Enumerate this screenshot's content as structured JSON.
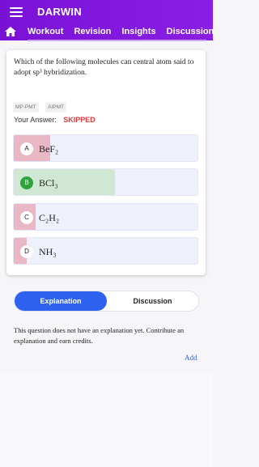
{
  "header": {
    "title": "DARWIN",
    "nav": [
      "Workout",
      "Revision",
      "Insights",
      "Discussion"
    ]
  },
  "question": {
    "text": "Which of the following molecules can central atom said to adopt sp³ hybridization.",
    "tags": [
      "MP-PMT",
      "AIPMT"
    ],
    "answer_label": "Your Answer:",
    "answer_status": "SKIPPED"
  },
  "options": [
    {
      "letter": "A",
      "formula": "BeF₂",
      "fill_fraction": 0.2,
      "fill_color": "#e9b8c4"
    },
    {
      "letter": "B",
      "formula": "BCl₃",
      "fill_fraction": 0.55,
      "fill_color": "#cfe7d3",
      "correct": true
    },
    {
      "letter": "C",
      "formula": "C₂H₂",
      "fill_fraction": 0.12,
      "fill_color": "#e9b8c4"
    },
    {
      "letter": "D",
      "formula": "NH₃",
      "fill_fraction": 0.07,
      "fill_color": "#e9b8c4"
    }
  ],
  "tabs": {
    "explanation": "Explanation",
    "discussion": "Discussion"
  },
  "explanation": {
    "text": "This question does not have an explanation yet. Contribute an explanation and earn credits.",
    "add_link": "Add"
  },
  "colors": {
    "header_bg": "#7a12d6",
    "accent_blue": "#2f62ee",
    "skipped_red": "#e03a3a",
    "correct_green": "#2ea43a"
  }
}
